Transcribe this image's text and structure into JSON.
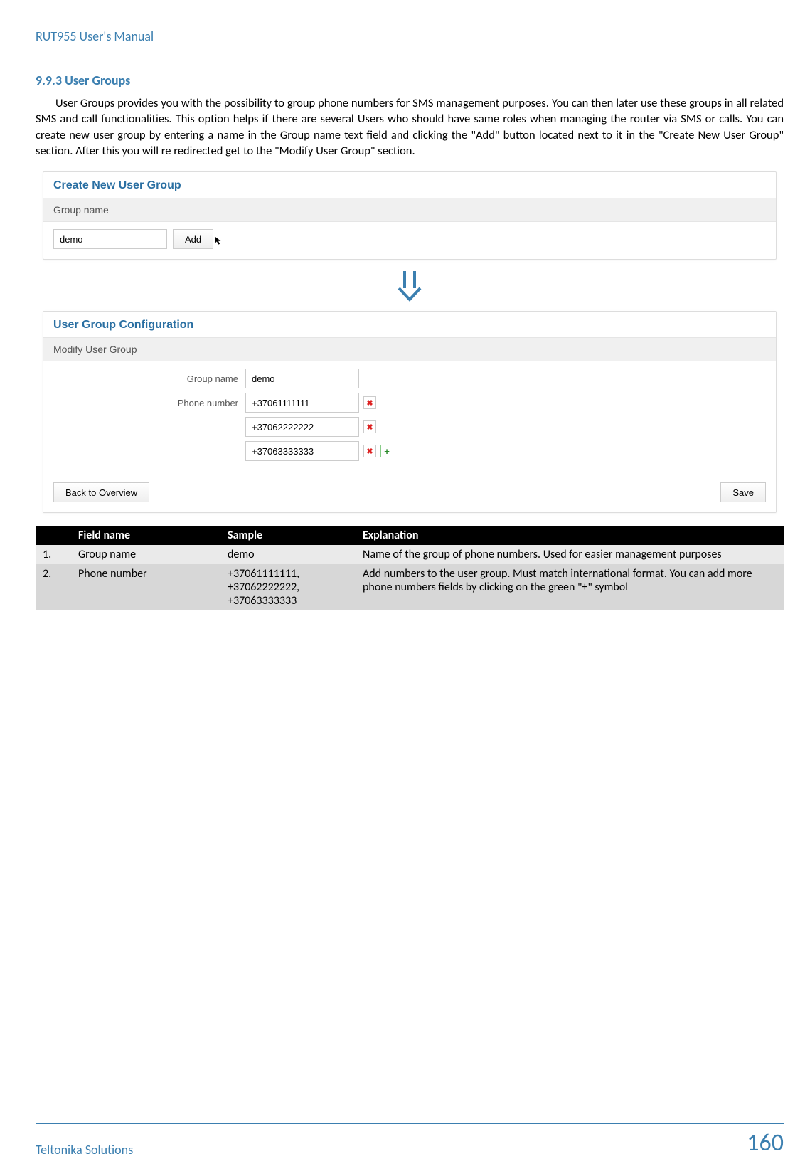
{
  "header": "RUT955 User's Manual",
  "section": {
    "number": "9.9.3",
    "title": "User Groups"
  },
  "paragraph": "User Groups provides you with the possibility to group phone numbers for SMS management purposes. You can then later use these groups in all related SMS and call functionalities. This option helps if there are several Users who should have same roles when managing the router via SMS or calls. You can create new user group by entering a name in the Group name text field and clicking the \"Add\" button located next to it in the \"Create New User Group\" section. After this you will re redirected get to the \"Modify User Group\" section.",
  "shot1": {
    "panel_title": "Create New User Group",
    "bar_label": "Group name",
    "input_value": "demo",
    "add_label": "Add"
  },
  "shot2": {
    "config_title": "User Group Configuration",
    "panel_title": "Modify User Group",
    "rows": {
      "group_label": "Group name",
      "group_value": "demo",
      "phone_label": "Phone number",
      "p1": "+37061111111",
      "p2": "+37062222222",
      "p3": "+37063333333"
    },
    "back_label": "Back to Overview",
    "save_label": "Save"
  },
  "table": {
    "head": {
      "c1": "",
      "c2": "Field name",
      "c3": "Sample",
      "c4": "Explanation"
    },
    "rows": [
      {
        "n": "1.",
        "field": "Group name",
        "sample": "demo",
        "exp": "Name of the group of phone numbers. Used for easier management purposes"
      },
      {
        "n": "2.",
        "field": "Phone number",
        "sample": "+37061111111, +37062222222, +37063333333",
        "exp": "Add numbers to the user group. Must match international format. You can add more phone numbers fields by clicking on the green \"+\" symbol"
      }
    ]
  },
  "footer": {
    "left": "Teltonika Solutions",
    "page": "160"
  }
}
